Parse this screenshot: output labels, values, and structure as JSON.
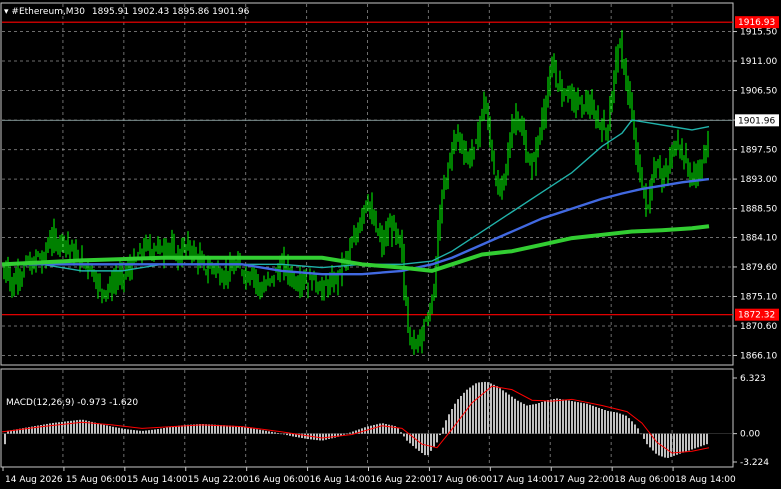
{
  "header": {
    "symbol": "#Ethereum,M30",
    "ohlc": "1895.91 1902.43 1895.86 1901.96"
  },
  "price_axis": {
    "ticks": [
      "1915.50",
      "1911.00",
      "1906.50",
      "1902.00",
      "1897.50",
      "1893.00",
      "1888.50",
      "1884.10",
      "1879.60",
      "1875.10",
      "1870.60",
      "1866.10"
    ],
    "current_price": "1901.96",
    "resistance_label": "1916.93",
    "support_label": "1872.32"
  },
  "macd": {
    "title": "MACD(12,26,9) -0.973 -1.620",
    "ticks": [
      "6.323",
      "0.00",
      "-3.224"
    ]
  },
  "time_axis": {
    "labels": [
      "14 Aug 2026",
      "15 Aug 06:00",
      "15 Aug 14:00",
      "15 Aug 22:00",
      "16 Aug 06:00",
      "16 Aug 14:00",
      "16 Aug 22:00",
      "17 Aug 06:00",
      "17 Aug 14:00",
      "17 Aug 22:00",
      "18 Aug 06:00",
      "18 Aug 14:00"
    ]
  },
  "colors": {
    "background": "#000000",
    "grid": "#c8c8c8",
    "candles": "#00ff00",
    "level_lines": "#ff0000",
    "ma_fast": "#20b2aa",
    "ma_mid": "#4169e1",
    "ma_slow": "#32cd32",
    "macd_hist": "#c0c0c0",
    "macd_signal": "#ff0000"
  },
  "chart_data": {
    "type": "candlestick",
    "price_range": [
      1864.8,
      1919.7
    ],
    "levels": {
      "resistance": 1916.93,
      "support": 1872.32,
      "current": 1901.96
    },
    "price_path": [
      [
        0,
        1878
      ],
      [
        5,
        1880
      ],
      [
        10,
        1876
      ],
      [
        15,
        1879
      ],
      [
        20,
        1878
      ],
      [
        25,
        1881
      ],
      [
        30,
        1879
      ],
      [
        35,
        1882
      ],
      [
        40,
        1880
      ],
      [
        45,
        1883
      ],
      [
        50,
        1884
      ],
      [
        55,
        1883
      ],
      [
        60,
        1884
      ],
      [
        65,
        1883
      ],
      [
        70,
        1882
      ],
      [
        75,
        1881
      ],
      [
        80,
        1880
      ],
      [
        85,
        1880
      ],
      [
        90,
        1879
      ],
      [
        95,
        1877
      ],
      [
        100,
        1876
      ],
      [
        105,
        1876
      ],
      [
        110,
        1877
      ],
      [
        115,
        1878
      ],
      [
        120,
        1878
      ],
      [
        125,
        1879
      ],
      [
        130,
        1880
      ],
      [
        135,
        1881
      ],
      [
        140,
        1882
      ],
      [
        145,
        1883
      ],
      [
        150,
        1882
      ],
      [
        155,
        1883
      ],
      [
        160,
        1882
      ],
      [
        165,
        1883
      ],
      [
        170,
        1882
      ],
      [
        175,
        1881
      ],
      [
        180,
        1882
      ],
      [
        185,
        1883
      ],
      [
        190,
        1882
      ],
      [
        195,
        1881
      ],
      [
        200,
        1880
      ],
      [
        205,
        1879
      ],
      [
        210,
        1880
      ],
      [
        215,
        1879
      ],
      [
        220,
        1878
      ],
      [
        225,
        1879
      ],
      [
        230,
        1879
      ],
      [
        235,
        1880
      ],
      [
        240,
        1879
      ],
      [
        245,
        1878
      ],
      [
        250,
        1879
      ],
      [
        255,
        1877
      ],
      [
        260,
        1876
      ],
      [
        265,
        1877
      ],
      [
        270,
        1878
      ],
      [
        275,
        1879
      ],
      [
        280,
        1880
      ],
      [
        285,
        1879
      ],
      [
        290,
        1878
      ],
      [
        295,
        1877
      ],
      [
        300,
        1878
      ],
      [
        305,
        1877
      ],
      [
        310,
        1878
      ],
      [
        315,
        1877
      ],
      [
        320,
        1876
      ],
      [
        325,
        1877
      ],
      [
        330,
        1877
      ],
      [
        335,
        1878
      ],
      [
        340,
        1880
      ],
      [
        345,
        1881
      ],
      [
        350,
        1883
      ],
      [
        355,
        1885
      ],
      [
        360,
        1888
      ],
      [
        365,
        1890
      ],
      [
        370,
        1887
      ],
      [
        375,
        1885
      ],
      [
        380,
        1883
      ],
      [
        385,
        1885
      ],
      [
        390,
        1886
      ],
      [
        395,
        1884
      ],
      [
        400,
        1882
      ],
      [
        402,
        1876
      ],
      [
        404,
        1874
      ],
      [
        406,
        1871
      ],
      [
        408,
        1869
      ],
      [
        410,
        1868
      ],
      [
        413,
        1867
      ],
      [
        416,
        1869
      ],
      [
        420,
        1870
      ],
      [
        425,
        1872
      ],
      [
        430,
        1874
      ],
      [
        433,
        1878
      ],
      [
        436,
        1885
      ],
      [
        440,
        1890
      ],
      [
        445,
        1894
      ],
      [
        450,
        1898
      ],
      [
        455,
        1900
      ],
      [
        460,
        1898
      ],
      [
        465,
        1896
      ],
      [
        470,
        1897
      ],
      [
        475,
        1899
      ],
      [
        478,
        1902
      ],
      [
        482,
        1905
      ],
      [
        485,
        1902
      ],
      [
        488,
        1899
      ],
      [
        492,
        1894
      ],
      [
        496,
        1891
      ],
      [
        500,
        1892
      ],
      [
        505,
        1896
      ],
      [
        510,
        1901
      ],
      [
        515,
        1903
      ],
      [
        520,
        1900
      ],
      [
        525,
        1896
      ],
      [
        530,
        1895
      ],
      [
        535,
        1898
      ],
      [
        540,
        1902
      ],
      [
        545,
        1906
      ],
      [
        550,
        1910
      ],
      [
        555,
        1908
      ],
      [
        560,
        1906
      ],
      [
        565,
        1907
      ],
      [
        570,
        1905
      ],
      [
        575,
        1905
      ],
      [
        580,
        1904
      ],
      [
        585,
        1905
      ],
      [
        590,
        1903
      ],
      [
        595,
        1902
      ],
      [
        600,
        1901
      ],
      [
        605,
        1900
      ],
      [
        610,
        1906
      ],
      [
        614,
        1912
      ],
      [
        618,
        1913
      ],
      [
        622,
        1910
      ],
      [
        626,
        1906
      ],
      [
        630,
        1902
      ],
      [
        635,
        1896
      ],
      [
        640,
        1892
      ],
      [
        645,
        1888
      ],
      [
        650,
        1893
      ],
      [
        655,
        1896
      ],
      [
        660,
        1893
      ],
      [
        665,
        1894
      ],
      [
        670,
        1897
      ],
      [
        675,
        1899
      ],
      [
        680,
        1897
      ],
      [
        685,
        1895
      ],
      [
        690,
        1893
      ],
      [
        695,
        1894
      ],
      [
        700,
        1895
      ],
      [
        705,
        1898
      ],
      [
        707,
        1901.96
      ]
    ],
    "ma_fast": [
      [
        0,
        1880
      ],
      [
        40,
        1880
      ],
      [
        80,
        1879
      ],
      [
        120,
        1879
      ],
      [
        160,
        1880
      ],
      [
        200,
        1880
      ],
      [
        240,
        1880
      ],
      [
        280,
        1880
      ],
      [
        320,
        1879.5
      ],
      [
        360,
        1880
      ],
      [
        400,
        1880
      ],
      [
        430,
        1880.5
      ],
      [
        450,
        1882
      ],
      [
        480,
        1885
      ],
      [
        510,
        1888
      ],
      [
        540,
        1891
      ],
      [
        570,
        1894
      ],
      [
        600,
        1898
      ],
      [
        620,
        1900
      ],
      [
        630,
        1902
      ],
      [
        650,
        1901.5
      ],
      [
        670,
        1901
      ],
      [
        690,
        1900.5
      ],
      [
        707,
        1901
      ]
    ],
    "ma_mid": [
      [
        0,
        1880
      ],
      [
        40,
        1880
      ],
      [
        80,
        1880
      ],
      [
        120,
        1880
      ],
      [
        160,
        1880
      ],
      [
        200,
        1880
      ],
      [
        240,
        1880
      ],
      [
        280,
        1879
      ],
      [
        320,
        1878.5
      ],
      [
        360,
        1878.5
      ],
      [
        400,
        1879
      ],
      [
        430,
        1880
      ],
      [
        450,
        1881
      ],
      [
        480,
        1883
      ],
      [
        510,
        1885
      ],
      [
        540,
        1887
      ],
      [
        570,
        1888.5
      ],
      [
        600,
        1890
      ],
      [
        620,
        1890.8
      ],
      [
        640,
        1891.5
      ],
      [
        660,
        1892
      ],
      [
        680,
        1892.5
      ],
      [
        707,
        1893
      ]
    ],
    "ma_slow": [
      [
        0,
        1880
      ],
      [
        40,
        1880.3
      ],
      [
        80,
        1880.6
      ],
      [
        120,
        1880.8
      ],
      [
        160,
        1881
      ],
      [
        200,
        1881
      ],
      [
        240,
        1881
      ],
      [
        280,
        1881
      ],
      [
        320,
        1881
      ],
      [
        360,
        1880
      ],
      [
        400,
        1879.5
      ],
      [
        430,
        1879
      ],
      [
        450,
        1880
      ],
      [
        480,
        1881.5
      ],
      [
        510,
        1882
      ],
      [
        540,
        1883
      ],
      [
        570,
        1884
      ],
      [
        600,
        1884.5
      ],
      [
        630,
        1885
      ],
      [
        660,
        1885.2
      ],
      [
        690,
        1885.5
      ],
      [
        707,
        1885.8
      ]
    ],
    "macd": {
      "range": [
        -3.224,
        6.323
      ],
      "histogram": [
        [
          5,
          0.3
        ],
        [
          20,
          0.6
        ],
        [
          35,
          0.9
        ],
        [
          50,
          1.2
        ],
        [
          65,
          1.4
        ],
        [
          80,
          1.6
        ],
        [
          95,
          1.2
        ],
        [
          110,
          0.8
        ],
        [
          125,
          0.5
        ],
        [
          140,
          0.3
        ],
        [
          155,
          0.5
        ],
        [
          170,
          0.8
        ],
        [
          185,
          1.0
        ],
        [
          200,
          1.1
        ],
        [
          215,
          1.0
        ],
        [
          230,
          0.9
        ],
        [
          245,
          0.7
        ],
        [
          260,
          0.4
        ],
        [
          275,
          0.1
        ],
        [
          290,
          -0.3
        ],
        [
          305,
          -0.6
        ],
        [
          320,
          -0.8
        ],
        [
          335,
          -0.4
        ],
        [
          350,
          0.2
        ],
        [
          365,
          0.8
        ],
        [
          380,
          1.2
        ],
        [
          395,
          0.8
        ],
        [
          405,
          -0.8
        ],
        [
          415,
          -1.8
        ],
        [
          425,
          -2.6
        ],
        [
          435,
          -1.0
        ],
        [
          445,
          1.8
        ],
        [
          455,
          3.8
        ],
        [
          465,
          5.0
        ],
        [
          475,
          5.8
        ],
        [
          485,
          5.9
        ],
        [
          495,
          5.4
        ],
        [
          505,
          4.6
        ],
        [
          515,
          3.8
        ],
        [
          525,
          3.2
        ],
        [
          535,
          3.4
        ],
        [
          545,
          3.8
        ],
        [
          555,
          4.0
        ],
        [
          565,
          3.8
        ],
        [
          575,
          3.6
        ],
        [
          585,
          3.4
        ],
        [
          595,
          3.0
        ],
        [
          605,
          2.6
        ],
        [
          615,
          2.4
        ],
        [
          625,
          2.0
        ],
        [
          635,
          0.8
        ],
        [
          645,
          -1.2
        ],
        [
          655,
          -2.4
        ],
        [
          665,
          -2.8
        ],
        [
          675,
          -2.4
        ],
        [
          685,
          -2.0
        ],
        [
          695,
          -1.6
        ],
        [
          705,
          -1.2
        ]
      ],
      "signal": [
        [
          0,
          0.2
        ],
        [
          40,
          0.8
        ],
        [
          80,
          1.3
        ],
        [
          110,
          1.0
        ],
        [
          140,
          0.6
        ],
        [
          170,
          0.8
        ],
        [
          200,
          1.0
        ],
        [
          240,
          0.8
        ],
        [
          280,
          0.2
        ],
        [
          320,
          -0.5
        ],
        [
          350,
          -0.1
        ],
        [
          380,
          0.9
        ],
        [
          400,
          0.6
        ],
        [
          420,
          -1.2
        ],
        [
          435,
          -1.6
        ],
        [
          450,
          0.5
        ],
        [
          470,
          3.5
        ],
        [
          490,
          5.4
        ],
        [
          510,
          5.0
        ],
        [
          530,
          3.8
        ],
        [
          550,
          3.7
        ],
        [
          570,
          3.9
        ],
        [
          600,
          3.2
        ],
        [
          625,
          2.5
        ],
        [
          640,
          1.2
        ],
        [
          655,
          -1.0
        ],
        [
          670,
          -2.2
        ],
        [
          690,
          -2.0
        ],
        [
          707,
          -1.6
        ]
      ]
    }
  }
}
